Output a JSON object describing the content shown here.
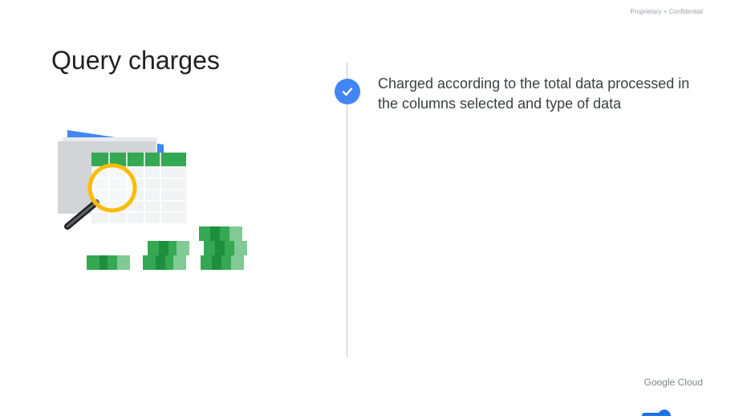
{
  "header": {
    "confidential_label": "Proprietary + Confidential",
    "title": "Query charges"
  },
  "content": {
    "bullets": [
      {
        "icon": "check-circle-icon",
        "text": "Charged according to the total data processed in the columns selected and type of data"
      }
    ]
  },
  "footer": {
    "brand": "Google Cloud"
  },
  "colors": {
    "accent_blue": "#4285f4",
    "green": "#34a853",
    "yellow": "#fbbc04",
    "divider": "#c6c9ce"
  }
}
